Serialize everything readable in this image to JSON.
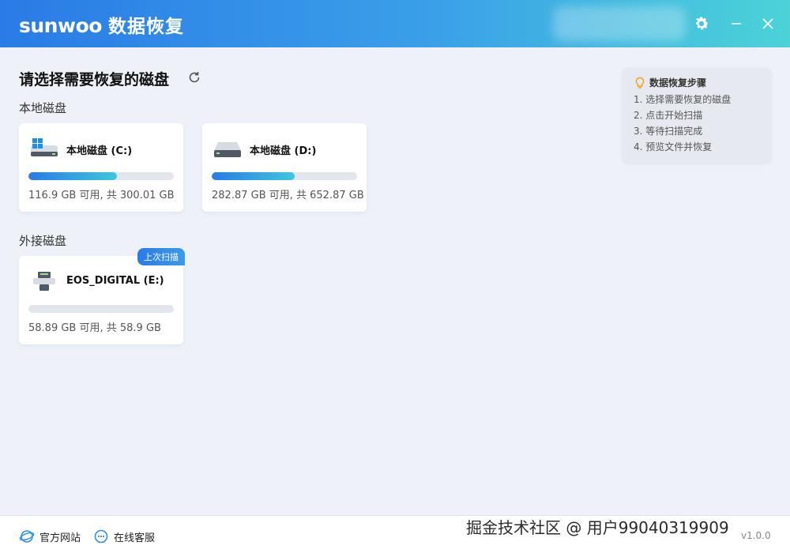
{
  "app": {
    "brand_en": "sunwoo",
    "brand_zh": "数据恢复"
  },
  "titlebar": {
    "settings_icon": "gear-icon",
    "minimize_icon": "minimize-icon",
    "close_icon": "close-icon"
  },
  "main": {
    "title": "请选择需要恢复的磁盘",
    "refresh_icon": "refresh-icon",
    "local_section": "本地磁盘",
    "external_section": "外接磁盘"
  },
  "local_disks": [
    {
      "name": "本地磁盘 (C:)",
      "info": "116.9 GB 可用, 共 300.01 GB",
      "used_fraction": 0.61,
      "icon": "windows-drive-icon"
    },
    {
      "name": "本地磁盘 (D:)",
      "info": "282.87 GB 可用, 共 652.87 GB",
      "used_fraction": 0.57,
      "icon": "hard-drive-icon"
    }
  ],
  "external_disks": [
    {
      "name": "EOS_DIGITAL (E:)",
      "info": "58.89 GB 可用, 共 58.9 GB",
      "used_fraction": 0.0,
      "badge": "上次扫描",
      "icon": "usb-drive-icon"
    }
  ],
  "steps": {
    "title": "数据恢复步骤",
    "items": [
      "1. 选择需要恢复的磁盘",
      "2. 点击开始扫描",
      "3. 等待扫描完成",
      "4. 预览文件并恢复"
    ]
  },
  "footer": {
    "website": "官方网站",
    "support": "在线客服",
    "version": "v1.0.0"
  },
  "watermark": "掘金技术社区 @ 用户99040319909",
  "colors": {
    "accent": "#2a7be6",
    "accent_end": "#4bd3d8"
  }
}
